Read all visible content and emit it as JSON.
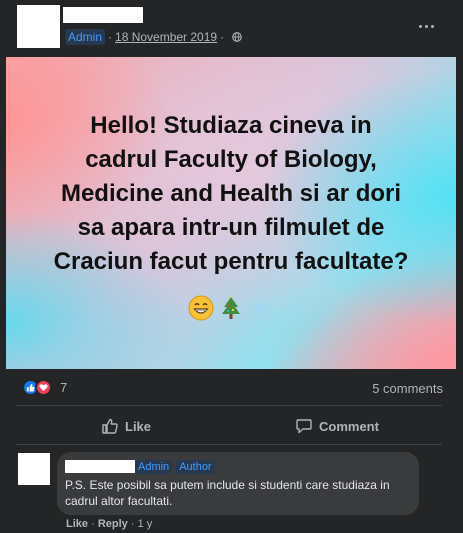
{
  "post": {
    "role_badge": "Admin",
    "separator": "·",
    "date": "18 November 2019",
    "separator2": "·",
    "card_lines": [
      "Hello! Studiaza cineva in",
      "cadrul Faculty of Biology,",
      "Medicine and Health si ar dori",
      "sa apara intr-un filmulet de",
      "Craciun facut pentru facultate?"
    ],
    "emojis": [
      "😁",
      "🎄",
      "❄️"
    ],
    "reaction_count": "7",
    "comment_count": "5 comments",
    "like_label": "Like",
    "comment_label": "Comment",
    "icons": {
      "more": "more-horizontal-icon",
      "audience": "globe-icon",
      "like_reaction": "thumbs-up-icon",
      "love_reaction": "heart-icon"
    }
  },
  "comment": {
    "badge_admin": "Admin",
    "badge_author": "Author",
    "text": "P.S. Este posibil sa putem include si studenti care studiaza in cadrul altor facultati.",
    "like": "Like",
    "sep1": "·",
    "reply": "Reply",
    "sep2": "·",
    "age": "1 y"
  },
  "colors": {
    "background": "#242526",
    "badge_bg": "#263951",
    "badge_text": "#4599ff",
    "bubble": "#3a3b3c",
    "secondary_text": "#b0b3b8"
  }
}
